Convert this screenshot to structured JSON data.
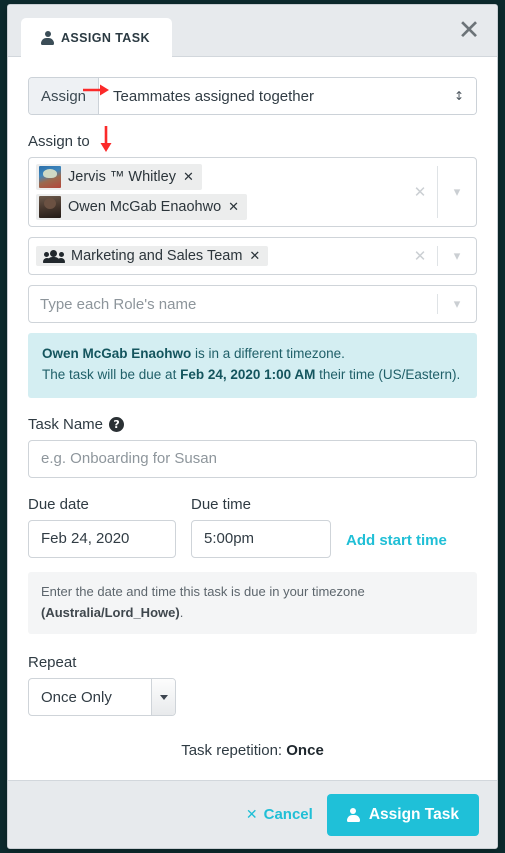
{
  "header": {
    "tab_label": "ASSIGN TASK",
    "tab_icon": "person-icon",
    "close_icon": "close-icon"
  },
  "assign_type": {
    "prefix_label": "Assign",
    "selected": "Teammates assigned together",
    "options": [
      "Teammates assigned together"
    ],
    "indicator_icon": "up-down-arrow-icon",
    "annotation_icon": "red-right-arrow"
  },
  "assign_to": {
    "label": "Assign to",
    "annotation_icon": "red-down-arrow",
    "members": [
      {
        "name": "Jervis ™ Whitley",
        "avatar": "avatar-jervis",
        "remove_icon": "close-icon"
      },
      {
        "name": "Owen McGab Enaohwo",
        "avatar": "avatar-owen",
        "remove_icon": "close-icon"
      }
    ],
    "groups": [
      {
        "name": "Marketing and Sales Team",
        "icon": "users-icon",
        "remove_icon": "close-icon"
      }
    ],
    "roles_placeholder": "Type each Role's name",
    "clear_icon": "clear-icon",
    "chevron_icon": "chevron-down-icon"
  },
  "timezone_alert": {
    "person": "Owen McGab Enaohwo",
    "line1_rest": " is in a different timezone.",
    "line2_prefix": "The task will be due at ",
    "line2_datetime": "Feb 24, 2020 1:00 AM",
    "line2_suffix": " their time (US/Eastern).",
    "bg_color": "#d4eef2",
    "text_color": "#1f5f68"
  },
  "task_name": {
    "label": "Task Name",
    "help_icon": "help-icon",
    "placeholder": "e.g. Onboarding for Susan",
    "value": ""
  },
  "due": {
    "date_label": "Due date",
    "time_label": "Due time",
    "date_value": "Feb 24, 2020",
    "time_value": "5:00pm",
    "add_start_time_label": "Add start time",
    "note_prefix": "Enter the date and time this task is due in your timezone ",
    "note_timezone": "(Australia/Lord_Howe)",
    "note_suffix": "."
  },
  "repeat": {
    "label": "Repeat",
    "selected": "Once Only",
    "options": [
      "Once Only"
    ],
    "repetition_prefix": "Task repetition: ",
    "repetition_value": "Once"
  },
  "footer": {
    "cancel_label": "Cancel",
    "cancel_icon": "close-icon",
    "assign_label": "Assign Task",
    "assign_icon": "person-icon",
    "accent_color": "#1fc0d8"
  }
}
